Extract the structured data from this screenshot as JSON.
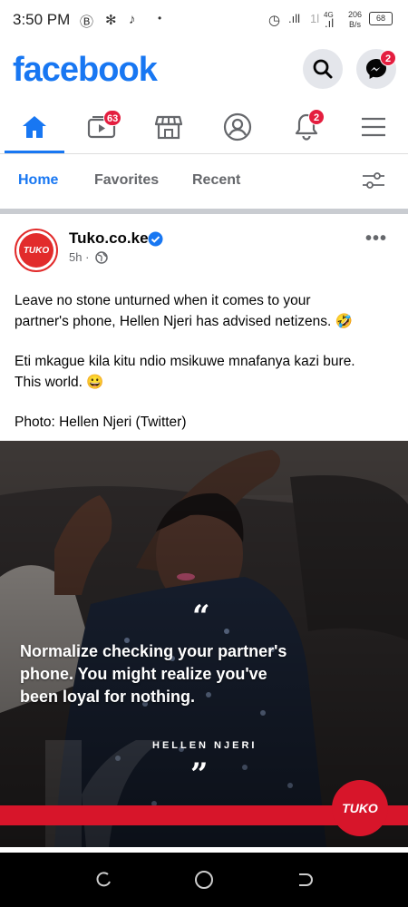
{
  "status_bar": {
    "time": "3:50 PM",
    "network_speed": "206",
    "network_unit": "B/s",
    "network_type": "4G",
    "battery": "68"
  },
  "header": {
    "logo": "facebook",
    "search_icon": "search-icon",
    "messenger_icon": "messenger-icon",
    "messenger_badge": "2"
  },
  "nav": {
    "items": [
      {
        "name": "home",
        "icon": "home-icon"
      },
      {
        "name": "watch",
        "icon": "video-icon",
        "badge": "63"
      },
      {
        "name": "marketplace",
        "icon": "store-icon"
      },
      {
        "name": "profile",
        "icon": "profile-icon"
      },
      {
        "name": "notifications",
        "icon": "bell-icon",
        "badge": "2"
      },
      {
        "name": "menu",
        "icon": "menu-icon"
      }
    ]
  },
  "feed_tabs": {
    "home": "Home",
    "favorites": "Favorites",
    "recent": "Recent",
    "filter_icon": "filter-icon"
  },
  "post": {
    "page_name": "Tuko.co.ke",
    "avatar_text": "TUKO",
    "time": "5h",
    "line1a": "Leave no stone unturned when it comes to your",
    "line1b": "partner's phone, Hellen Njeri has advised netizens. 🤣",
    "line2a": "Eti mkague kila kitu ndio msikuwe mnafanya kazi bure.",
    "line2b": "This world. 😀",
    "line3": "Photo: Hellen Njeri (Twitter)",
    "image": {
      "quote_line1": "Normalize checking your partner's",
      "quote_line2": "phone. You might realize you've",
      "quote_line3": "been loyal for nothing.",
      "attribution": "HELLEN NJERI",
      "open_quote": "“",
      "close_quote": "”",
      "brand": "TUKO"
    }
  },
  "colors": {
    "brand": "#1877f2",
    "badge": "#e41e3f",
    "tuko_red": "#d7152a"
  }
}
